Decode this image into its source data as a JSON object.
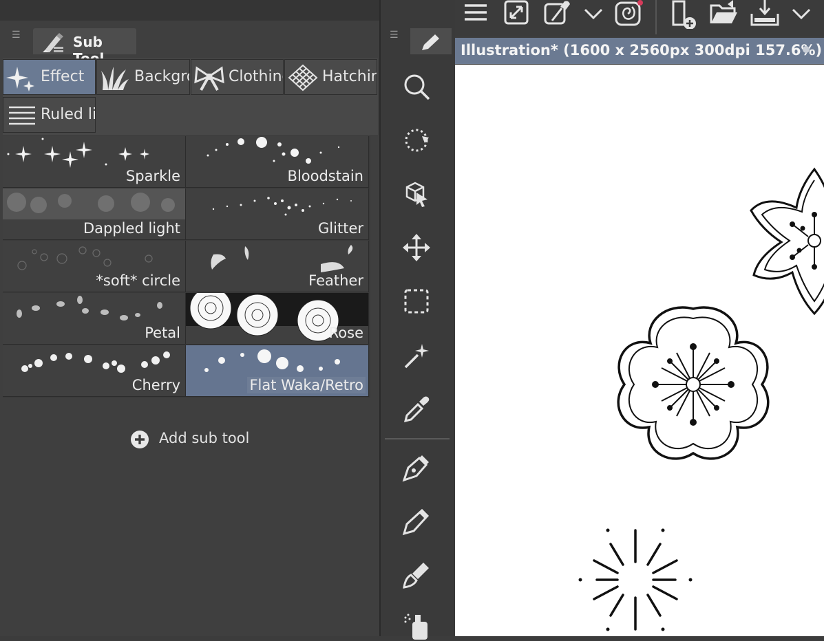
{
  "subtool_panel": {
    "tab_label": "Sub Tool",
    "groups": [
      {
        "label": "Effect",
        "icon": "sparkle-icon",
        "active": true
      },
      {
        "label": "Backgro",
        "icon": "grass-icon",
        "active": false
      },
      {
        "label": "Clothing",
        "icon": "bow-icon",
        "active": false
      },
      {
        "label": "Hatchin",
        "icon": "crosshatch-icon",
        "active": false
      },
      {
        "label": "Ruled li",
        "icon": "ruled-lines-icon",
        "active": false
      }
    ],
    "tools": [
      {
        "name": "Sparkle",
        "active": false
      },
      {
        "name": "Bloodstain",
        "active": false
      },
      {
        "name": "Dappled light",
        "active": false
      },
      {
        "name": "Glitter",
        "active": false
      },
      {
        "name": "*soft* circle",
        "active": false
      },
      {
        "name": "Feather",
        "active": false
      },
      {
        "name": "Petal",
        "active": false
      },
      {
        "name": "Rose",
        "active": false
      },
      {
        "name": "Cherry",
        "active": false
      },
      {
        "name": "Flat Waka/Retro",
        "active": true
      }
    ],
    "add_button": "Add sub tool"
  },
  "tool_column": {
    "icons": [
      "zoom-icon",
      "rotate-icon",
      "object-select-icon",
      "move-icon",
      "selection-icon",
      "auto-select-wand-icon",
      "eyedropper-icon",
      "pen-icon",
      "pencil-icon",
      "brush-icon",
      "airbrush-icon"
    ]
  },
  "top_toolbar": {
    "icons": [
      "menu-icon",
      "fit-to-screen-icon",
      "color-picker-icon",
      "dropdown-chevron-icon",
      "spiral-app-icon",
      "new-file-icon",
      "open-folder-icon",
      "save-export-icon",
      "dropdown-chevron-icon"
    ]
  },
  "canvas": {
    "title": "Illustration* (1600 x 2560px 300dpi 157.6%)"
  },
  "colors": {
    "panel_bg": "#3f3f3f",
    "active_blue": "#6a7a93",
    "canvas_bg": "#ffffff"
  }
}
